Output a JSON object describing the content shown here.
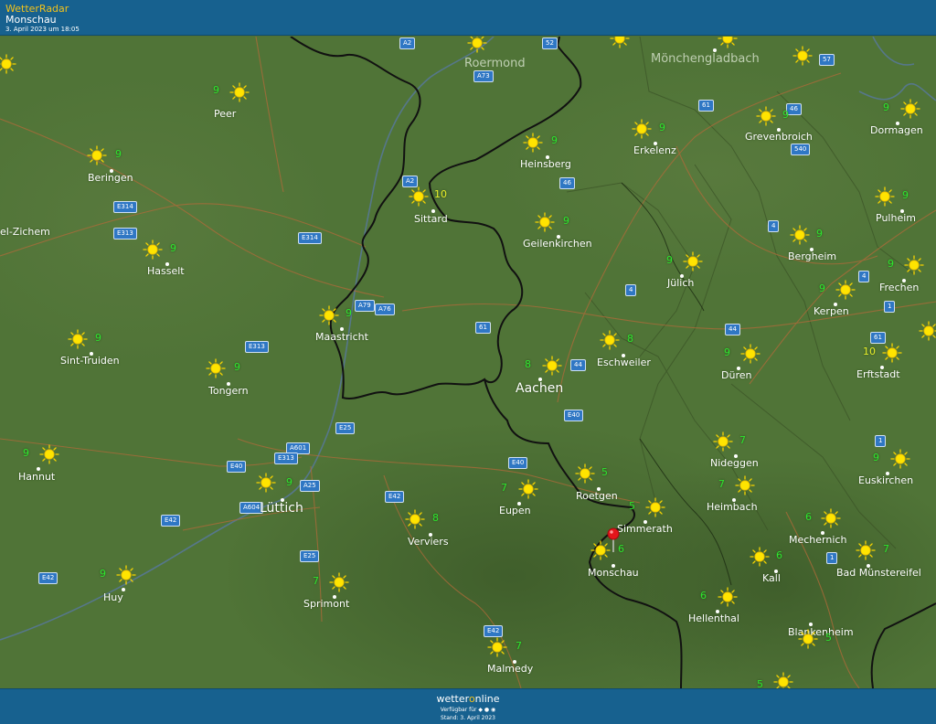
{
  "header": {
    "app_name": "WetterRadar",
    "location": "Monschau",
    "timestamp": "3. April 2023 um 18:05"
  },
  "footer": {
    "brand_prefix": "wetter",
    "brand_o": "o",
    "brand_suffix": "nline",
    "available": "Verfügbar für",
    "stand": "Stand: 3. April 2023"
  },
  "colors": {
    "bar": "#17618f",
    "map_base": "#4e7136",
    "temp_normal": "#2ee62e",
    "temp_warm": "#e9ef2a",
    "sun": "#f7d400",
    "road_badge": "#2f77c4"
  },
  "icons": {
    "weather": "sun-icon",
    "marker": "location-pin-icon"
  },
  "cities": [
    {
      "name": "Roermond",
      "temp": null
    },
    {
      "name": "Mönchengladbach",
      "temp": null
    },
    {
      "name": "Peer",
      "temp": "9"
    },
    {
      "name": "Beringen",
      "temp": "9"
    },
    {
      "name": "el-Zichem",
      "temp": null
    },
    {
      "name": "Hasselt",
      "temp": "9"
    },
    {
      "name": "Sint-Truiden",
      "temp": "9"
    },
    {
      "name": "Tongern",
      "temp": "9"
    },
    {
      "name": "Hannut",
      "temp": "9"
    },
    {
      "name": "Lüttich",
      "temp": "9"
    },
    {
      "name": "Huy",
      "temp": "9"
    },
    {
      "name": "Sprimont",
      "temp": "7"
    },
    {
      "name": "Verviers",
      "temp": "8"
    },
    {
      "name": "Eupen",
      "temp": "7"
    },
    {
      "name": "Malmedy",
      "temp": "7"
    },
    {
      "name": "Maastricht",
      "temp": "9"
    },
    {
      "name": "Sittard",
      "temp": "10"
    },
    {
      "name": "Heinsberg",
      "temp": "9"
    },
    {
      "name": "Geilenkirchen",
      "temp": "9"
    },
    {
      "name": "Erkelenz",
      "temp": "9"
    },
    {
      "name": "Aachen",
      "temp": "8"
    },
    {
      "name": "Eschweiler",
      "temp": "8"
    },
    {
      "name": "Jülich",
      "temp": "9"
    },
    {
      "name": "Düren",
      "temp": "9"
    },
    {
      "name": "Roetgen",
      "temp": "5"
    },
    {
      "name": "Simmerath",
      "temp": "5"
    },
    {
      "name": "Monschau",
      "temp": "6"
    },
    {
      "name": "Nideggen",
      "temp": "7"
    },
    {
      "name": "Heimbach",
      "temp": "7"
    },
    {
      "name": "Hellenthal",
      "temp": "6"
    },
    {
      "name": "Kall",
      "temp": "6"
    },
    {
      "name": "Mechernich",
      "temp": "6"
    },
    {
      "name": "Bad Münstereifel",
      "temp": "7"
    },
    {
      "name": "Blankenheim",
      "temp": "5"
    },
    {
      "name": "Euskirchen",
      "temp": "9"
    },
    {
      "name": "Erftstadt",
      "temp": "10"
    },
    {
      "name": "Kerpen",
      "temp": "9"
    },
    {
      "name": "Frechen",
      "temp": "9"
    },
    {
      "name": "Bergheim",
      "temp": "9"
    },
    {
      "name": "Pulheim",
      "temp": "9"
    },
    {
      "name": "Grevenbroich",
      "temp": "9"
    },
    {
      "name": "Dormagen",
      "temp": "9"
    }
  ],
  "roads": [
    "A2",
    "52",
    "A73",
    "61",
    "46",
    "57",
    "540",
    "46",
    "E314",
    "E313",
    "E314",
    "A2",
    "A79",
    "A76",
    "61",
    "4",
    "44",
    "4",
    "1",
    "61",
    "E313",
    "E25",
    "A601",
    "E40",
    "E313",
    "A25",
    "A604",
    "E40",
    "E42",
    "E40",
    "44",
    "4",
    "1",
    "1",
    "E42",
    "E25",
    "E42",
    "E42"
  ],
  "unlabeled_temps": [
    "5"
  ]
}
